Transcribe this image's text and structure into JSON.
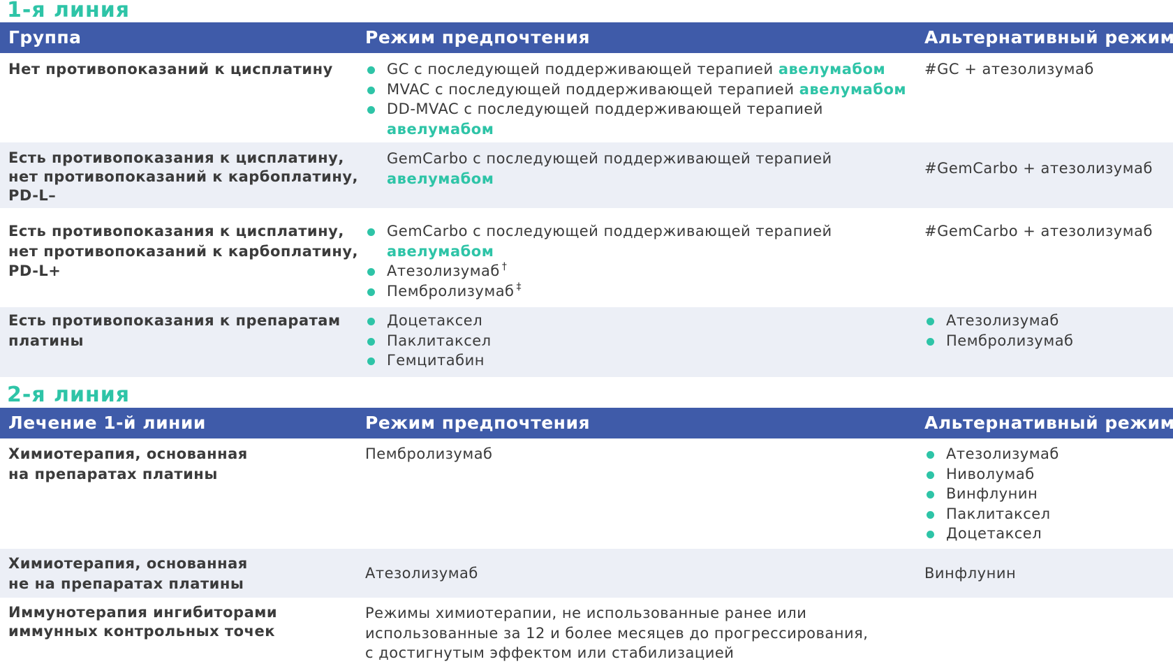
{
  "line1": {
    "title": "1-я линия",
    "header": {
      "col1": "Группа",
      "col2": "Режим предпочтения",
      "col3": "Альтернативный режим"
    },
    "rows": [
      {
        "group": "Нет противопоказаний к цисплатину",
        "preferred": [
          {
            "text": "GC с последующей поддерживающей терапией",
            "accent": "авелумабом"
          },
          {
            "text": "MVAC с последующей поддерживающей терапией",
            "accent": "авелумабом"
          },
          {
            "text": "DD-MVAC с последующей поддерживающей терапией",
            "accent": "авелумабом"
          }
        ],
        "alternative": "#GC + атезолизумаб"
      },
      {
        "group_lines": [
          "Есть противопоказания к цисплатину,",
          "нет  противопоказаний к карбоплатину,",
          "PD-L–"
        ],
        "preferred": {
          "text": "GemCarbo с последующей поддерживающей терапией",
          "accent": "авелумабом"
        },
        "alternative": "#GemCarbo + атезолизумаб"
      },
      {
        "group_lines": [
          "Есть противопоказания к цисплатину,",
          "нет противопоказаний к карбоплатину,",
          "PD-L+"
        ],
        "preferred": [
          {
            "text": "GemCarbo с последующей поддерживающей терапией",
            "accent": "авелумабом"
          },
          {
            "text": "Атезолизумаб",
            "sup": "†"
          },
          {
            "text": "Пембролизумаб",
            "sup": "‡"
          }
        ],
        "alternative": "#GemCarbo + атезолизумаб"
      },
      {
        "group_lines": [
          "Есть противопоказания к препаратам",
          "платины"
        ],
        "preferred": [
          "Доцетаксел",
          "Паклитаксел",
          "Гемцитабин"
        ],
        "alternative": [
          "Атезолизумаб",
          "Пембролизумаб"
        ]
      }
    ]
  },
  "line2": {
    "title": "2-я линия",
    "header": {
      "col1": "Лечение 1-й линии",
      "col2": "Режим предпочтения",
      "col3": "Альтернативный режим"
    },
    "rows": [
      {
        "group_lines": [
          "Химиотерапия, основанная",
          "на препаратах платины"
        ],
        "preferred": "Пембролизумаб",
        "alternative": [
          "Атезолизумаб",
          "Ниволумаб",
          "Винфлунин",
          "Паклитаксел",
          "Доцетаксел"
        ]
      },
      {
        "group_lines": [
          "Химиотерапия, основанная",
          "не на препаратах платины"
        ],
        "preferred": "Атезолизумаб",
        "alternative": "Винфлунин"
      },
      {
        "group_lines": [
          "Иммунотерапия ингибиторами",
          "иммунных контрольных точек"
        ],
        "preferred_lines": [
          "Режимы химиотерапии, не использованные ранее или",
          "использованные за 12 и более месяцев до прогрессирования,",
          "с достигнутым эффектом или стабилизацией"
        ],
        "alternative": ""
      }
    ]
  },
  "colors": {
    "header_bg": "#3f5ba9",
    "accent": "#2ec4a7",
    "shaded_row": "#eceff6",
    "text": "#3a3a3a"
  }
}
